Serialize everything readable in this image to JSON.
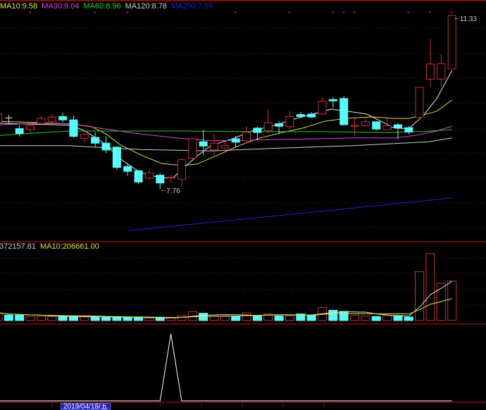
{
  "colors": {
    "up": "#c83232",
    "down": "#54fcfc",
    "doji": "#e0e0e0",
    "grid": "#7a1414",
    "separator": "#7a0f0f",
    "marker": "#c030c0"
  },
  "ma_legend": [
    {
      "label": "MA10:9.58",
      "color": "#e0e040"
    },
    {
      "label": "MA30:9.04",
      "color": "#e040e0"
    },
    {
      "label": "MA60:8.96",
      "color": "#20d020"
    },
    {
      "label": "MA120:8.78",
      "color": "#d0d0d0"
    },
    {
      "label": "MA250:7.59",
      "color": "#2020d0"
    }
  ],
  "vol_legend": [
    {
      "label": "372157.81",
      "color": "#d0d0d0"
    },
    {
      "label": "MA10:206661.00",
      "color": "#e0e040"
    }
  ],
  "date_label": "2019/04/18/五",
  "chart_data": [
    {
      "type": "candlestick",
      "panel": "price",
      "y_range": [
        6.6,
        11.6
      ],
      "high_label": "11.33",
      "low_label": "7.76",
      "candles": [
        [
          9.12,
          9.35,
          9.08,
          9.3
        ],
        [
          9.22,
          9.28,
          9.1,
          9.22
        ],
        [
          9.0,
          9.07,
          8.84,
          8.9
        ],
        [
          8.98,
          9.1,
          8.92,
          9.06
        ],
        [
          9.11,
          9.26,
          9.07,
          9.21
        ],
        [
          9.15,
          9.3,
          9.12,
          9.24
        ],
        [
          9.25,
          9.33,
          9.13,
          9.18
        ],
        [
          9.18,
          9.27,
          8.81,
          8.84
        ],
        [
          8.8,
          8.96,
          8.71,
          8.88
        ],
        [
          8.82,
          8.93,
          8.61,
          8.7
        ],
        [
          8.7,
          8.84,
          8.5,
          8.56
        ],
        [
          8.62,
          8.63,
          8.15,
          8.2
        ],
        [
          8.22,
          8.29,
          8.03,
          8.12
        ],
        [
          8.13,
          8.15,
          7.86,
          7.9
        ],
        [
          7.98,
          8.15,
          7.95,
          8.09
        ],
        [
          8.04,
          8.08,
          7.76,
          7.88
        ],
        [
          7.98,
          8.05,
          7.88,
          8.0
        ],
        [
          7.96,
          8.38,
          7.8,
          8.36
        ],
        [
          8.39,
          8.82,
          8.36,
          8.79
        ],
        [
          8.73,
          8.98,
          8.45,
          8.64
        ],
        [
          8.56,
          8.88,
          8.46,
          8.7
        ],
        [
          8.6,
          8.77,
          8.58,
          8.65
        ],
        [
          8.79,
          8.85,
          8.63,
          8.72
        ],
        [
          8.75,
          9.05,
          8.7,
          8.92
        ],
        [
          9.01,
          9.05,
          8.77,
          8.92
        ],
        [
          8.96,
          9.39,
          8.9,
          9.12
        ],
        [
          9.1,
          9.15,
          8.89,
          9.05
        ],
        [
          9.04,
          9.36,
          8.99,
          9.25
        ],
        [
          9.29,
          9.34,
          9.22,
          9.25
        ],
        [
          9.3,
          9.34,
          9.22,
          9.24
        ],
        [
          9.3,
          9.65,
          9.28,
          9.56
        ],
        [
          9.6,
          9.65,
          9.43,
          9.57
        ],
        [
          9.62,
          9.67,
          9.08,
          9.08
        ],
        [
          9.05,
          9.21,
          8.86,
          9.07
        ],
        [
          9.06,
          9.2,
          9.04,
          9.14
        ],
        [
          9.14,
          9.16,
          8.96,
          8.99
        ],
        [
          8.98,
          9.22,
          8.97,
          9.06
        ],
        [
          9.08,
          9.11,
          8.78,
          9.02
        ],
        [
          9.02,
          9.06,
          8.88,
          8.93
        ],
        [
          9.23,
          9.85,
          9.2,
          9.85
        ],
        [
          10.02,
          10.85,
          9.85,
          10.33
        ],
        [
          10.02,
          10.53,
          9.86,
          10.34
        ],
        [
          10.23,
          11.33,
          10.23,
          11.33
        ]
      ],
      "candle_fields": [
        "open",
        "high",
        "low",
        "close"
      ],
      "markers_at": [
        3,
        9,
        12,
        22,
        27,
        31,
        32,
        33,
        38,
        40,
        42
      ],
      "ma_lines": [
        {
          "color": "#e8e8e8",
          "points": [
            [
              0.2,
              9.11
            ],
            [
              6.7,
              9.07
            ],
            [
              8.0,
              8.96
            ],
            [
              10.0,
              8.67
            ],
            [
              11.3,
              8.38
            ],
            [
              13.2,
              8.09
            ],
            [
              15.2,
              7.98
            ],
            [
              16.2,
              7.99
            ],
            [
              17.1,
              8.17
            ],
            [
              18.4,
              8.43
            ],
            [
              19.7,
              8.65
            ],
            [
              21.7,
              8.79
            ],
            [
              23.6,
              8.96
            ],
            [
              25.6,
              9.07
            ],
            [
              27.6,
              9.21
            ],
            [
              30.8,
              9.4
            ],
            [
              32.0,
              9.37
            ],
            [
              34.1,
              9.3
            ],
            [
              36.7,
              9.01
            ],
            [
              38.0,
              9.0
            ],
            [
              39.3,
              9.26
            ],
            [
              40.6,
              9.62
            ],
            [
              42,
              10.2
            ]
          ]
        },
        {
          "name": "MA10",
          "color": "#e0e040",
          "points": [
            [
              0.2,
              9.15
            ],
            [
              6.7,
              9.1
            ],
            [
              8.7,
              9.04
            ],
            [
              10.0,
              8.89
            ],
            [
              11.3,
              8.67
            ],
            [
              13.2,
              8.46
            ],
            [
              15.2,
              8.28
            ],
            [
              17.1,
              8.24
            ],
            [
              18.4,
              8.27
            ],
            [
              20.4,
              8.46
            ],
            [
              22.3,
              8.65
            ],
            [
              24.3,
              8.81
            ],
            [
              26.3,
              8.92
            ],
            [
              28.2,
              9.01
            ],
            [
              30.2,
              9.15
            ],
            [
              32.1,
              9.21
            ],
            [
              34.7,
              9.24
            ],
            [
              36.7,
              9.21
            ],
            [
              38.0,
              9.21
            ],
            [
              39.3,
              9.28
            ],
            [
              40.6,
              9.36
            ],
            [
              42,
              9.59
            ]
          ]
        },
        {
          "name": "MA30",
          "color": "#e040e0",
          "points": [
            [
              0.2,
              9.08
            ],
            [
              3.5,
              9.11
            ],
            [
              6.7,
              9.1
            ],
            [
              10.0,
              8.99
            ],
            [
              13.2,
              8.89
            ],
            [
              16.5,
              8.81
            ],
            [
              19.7,
              8.75
            ],
            [
              23.0,
              8.76
            ],
            [
              26.3,
              8.78
            ],
            [
              29.5,
              8.79
            ],
            [
              32.8,
              8.81
            ],
            [
              36.7,
              8.81
            ],
            [
              38.6,
              8.86
            ],
            [
              40.6,
              8.95
            ],
            [
              42,
              9.05
            ]
          ]
        },
        {
          "name": "MA60",
          "color": "#20d020",
          "points": [
            [
              0.2,
              8.86
            ],
            [
              4.1,
              8.92
            ],
            [
              6.7,
              8.95
            ],
            [
              10.0,
              8.95
            ],
            [
              16.5,
              8.95
            ],
            [
              23.0,
              8.94
            ],
            [
              29.5,
              8.94
            ],
            [
              36.0,
              8.92
            ],
            [
              39.3,
              8.94
            ],
            [
              42,
              8.98
            ]
          ]
        },
        {
          "name": "MA120",
          "color": "#d0d0d0",
          "points": [
            [
              0.2,
              8.65
            ],
            [
              6.7,
              8.65
            ],
            [
              8.7,
              8.62
            ],
            [
              13.2,
              8.57
            ],
            [
              19.7,
              8.54
            ],
            [
              26.3,
              8.6
            ],
            [
              32.8,
              8.65
            ],
            [
              37.3,
              8.7
            ],
            [
              39.9,
              8.73
            ],
            [
              42,
              8.81
            ]
          ]
        },
        {
          "name": "MA250",
          "color": "#2020d0",
          "points": [
            [
              12.1,
              6.9
            ],
            [
              42,
              7.57
            ]
          ]
        }
      ]
    },
    {
      "type": "bar",
      "panel": "volume",
      "values": [
        73000,
        51000,
        51000,
        38000,
        38000,
        38000,
        38000,
        38000,
        33000,
        33000,
        33000,
        29000,
        29000,
        29000,
        24000,
        24000,
        24000,
        44000,
        86000,
        69000,
        42000,
        38000,
        42000,
        73000,
        44000,
        62000,
        42000,
        44000,
        62000,
        51000,
        122000,
        97000,
        86000,
        51000,
        42000,
        38000,
        47000,
        47000,
        33000,
        461000,
        631000,
        350000,
        372157.81
      ],
      "ma_lines": [
        {
          "color": "#e0e0e0",
          "window": 5
        },
        {
          "name": "MA10",
          "color": "#e0e040",
          "window": 10
        }
      ]
    },
    {
      "type": "line",
      "panel": "indicator",
      "values": [
        0,
        0,
        0,
        0,
        0,
        0,
        0,
        0,
        0,
        0,
        0,
        0,
        0,
        0,
        0,
        0,
        1,
        0,
        0,
        0,
        0,
        0,
        0,
        0,
        0,
        0,
        0,
        0,
        0,
        0,
        0,
        0,
        0,
        0,
        0,
        0,
        0,
        0,
        0,
        0,
        0,
        0,
        0
      ],
      "color": "#ffffff"
    }
  ]
}
